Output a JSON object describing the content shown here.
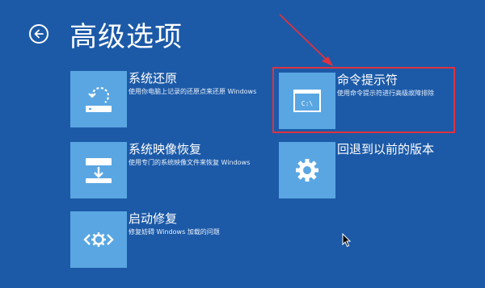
{
  "header": {
    "title": "高级选项"
  },
  "tiles": [
    {
      "title": "系统还原",
      "desc": "使用你电脑上记录的还原点来还原 Windows",
      "icon": "system-restore-icon"
    },
    {
      "title": "系统映像恢复",
      "desc": "使用专门的系统映像文件来恢复 Windows",
      "icon": "image-recovery-icon"
    },
    {
      "title": "启动修复",
      "desc": "修复妨碍 Windows 加载的问题",
      "icon": "startup-repair-icon"
    },
    {
      "title": "命令提示符",
      "desc": "使用命令提示符进行高级故障排除",
      "icon": "command-prompt-icon",
      "icon_text": "C:\\"
    },
    {
      "title": "回退到以前的版本",
      "desc": "",
      "icon": "gear-icon"
    }
  ],
  "colors": {
    "background": "#1c5aa8",
    "tile": "#5aa6e2",
    "highlight": "#e0323e"
  }
}
